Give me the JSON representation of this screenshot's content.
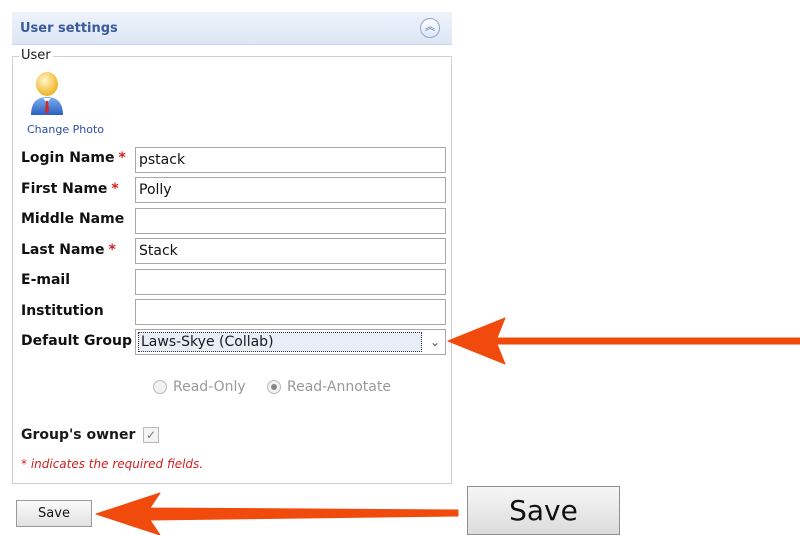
{
  "panel": {
    "title": "User settings",
    "collapse_icon": "double-chevron-up-icon",
    "legend": "User",
    "change_photo": "Change Photo"
  },
  "fields": {
    "login_name": {
      "label": "Login Name",
      "required": "*",
      "value": "pstack"
    },
    "first_name": {
      "label": "First Name",
      "required": "*",
      "value": "Polly"
    },
    "middle_name": {
      "label": "Middle Name",
      "value": ""
    },
    "last_name": {
      "label": "Last Name",
      "required": "*",
      "value": "Stack"
    },
    "email": {
      "label": "E-mail",
      "value": ""
    },
    "institution": {
      "label": "Institution",
      "value": ""
    },
    "default_group": {
      "label": "Default Group",
      "value": "Laws-Skye (Collab)"
    }
  },
  "permissions": {
    "read_only": "Read-Only",
    "read_annotate": "Read-Annotate",
    "selected": "Read-Annotate"
  },
  "owner": {
    "label": "Group's owner",
    "checked": true
  },
  "note": "* indicates the required fields.",
  "save_label": "Save",
  "save_zoom_label": "Save",
  "colors": {
    "arrow": "#f04a0c",
    "required": "#d02020",
    "header_text": "#3a5a9a"
  }
}
